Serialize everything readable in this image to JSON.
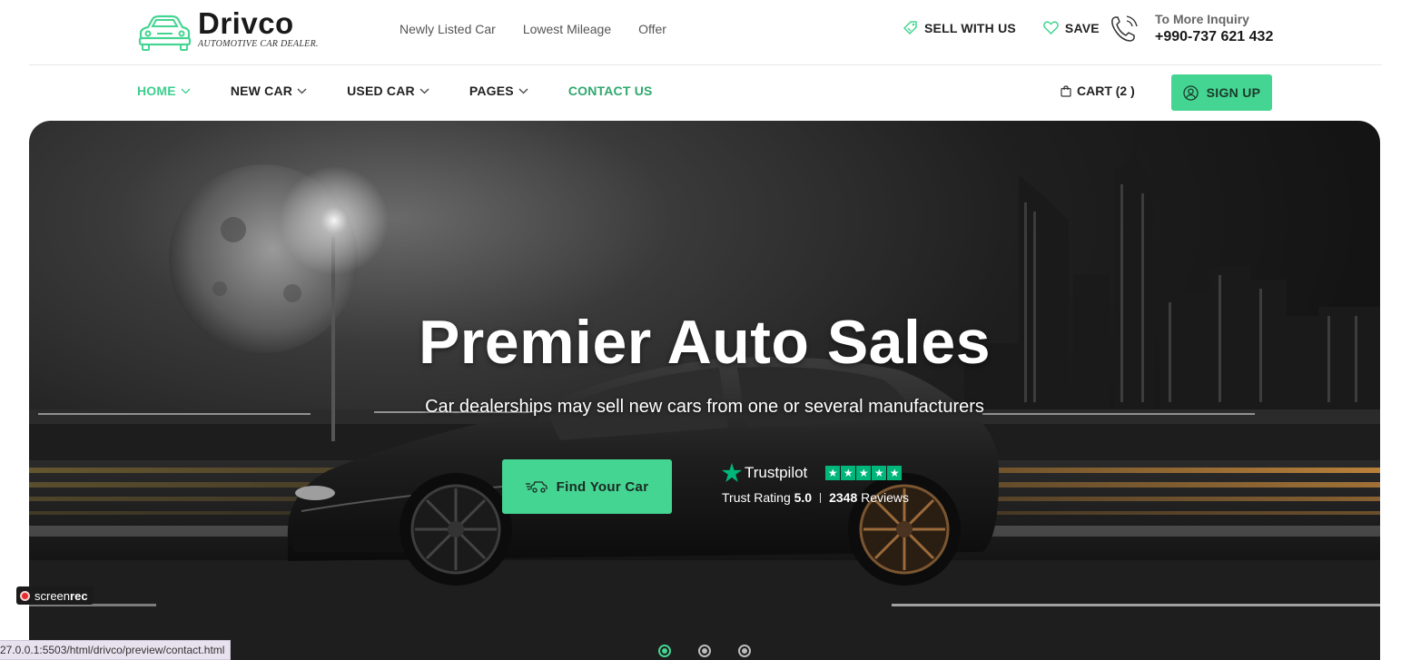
{
  "brand": {
    "name": "Drivco",
    "tagline": "AUTOMOTIVE CAR DEALER.",
    "accent": "#45d592"
  },
  "quicklinks": [
    "Newly Listed Car",
    "Lowest Mileage",
    "Offer"
  ],
  "top_actions": {
    "sell": "SELL WITH US",
    "save": "SAVE",
    "inquiry_label": "To More Inquiry",
    "inquiry_phone": "+990-737 621 432"
  },
  "nav": {
    "items": [
      {
        "label": "HOME",
        "dropdown": true,
        "state": "active"
      },
      {
        "label": "NEW CAR",
        "dropdown": true
      },
      {
        "label": "USED CAR",
        "dropdown": true
      },
      {
        "label": "PAGES",
        "dropdown": true
      },
      {
        "label": "CONTACT US",
        "dropdown": false
      }
    ],
    "cart": "CART (2 )",
    "signup": "SIGN UP"
  },
  "hero": {
    "title": "Premier Auto Sales",
    "subtitle": "Car dealerships may sell new cars from one or several manufacturers",
    "cta": "Find Your Car",
    "trust": {
      "brand": "Trustpilot",
      "stars": 5,
      "rating_label": "Trust Rating",
      "rating": "5.0",
      "reviews_count": "2348",
      "reviews_label": "Reviews"
    },
    "slides": 3,
    "active_slide": 1
  },
  "overlay": {
    "screenrec_a": "screen",
    "screenrec_b": "rec",
    "status_url": "27.0.0.1:5503/html/drivco/preview/contact.html"
  }
}
